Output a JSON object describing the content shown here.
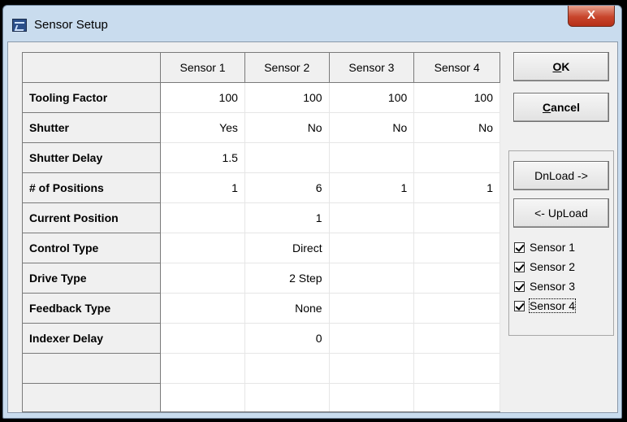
{
  "window": {
    "title": "Sensor Setup",
    "close_glyph": "X"
  },
  "grid": {
    "columns": [
      "Sensor 1",
      "Sensor 2",
      "Sensor 3",
      "Sensor 4"
    ],
    "rows": [
      {
        "label": "Tooling Factor",
        "values": [
          "100",
          "100",
          "100",
          "100"
        ]
      },
      {
        "label": "Shutter",
        "values": [
          "Yes",
          "No",
          "No",
          "No"
        ]
      },
      {
        "label": "Shutter Delay",
        "values": [
          "1.5",
          "",
          "",
          ""
        ]
      },
      {
        "label": "# of Positions",
        "values": [
          "1",
          "6",
          "1",
          "1"
        ]
      },
      {
        "label": "Current Position",
        "values": [
          "",
          "1",
          "",
          ""
        ]
      },
      {
        "label": "Control Type",
        "values": [
          "",
          "Direct",
          "",
          ""
        ]
      },
      {
        "label": "Drive Type",
        "values": [
          "",
          "2 Step",
          "",
          ""
        ]
      },
      {
        "label": "Feedback Type",
        "values": [
          "",
          "None",
          "",
          ""
        ]
      },
      {
        "label": "Indexer Delay",
        "values": [
          "",
          "0",
          "",
          ""
        ]
      },
      {
        "label": "",
        "values": [
          "",
          "",
          "",
          ""
        ]
      },
      {
        "label": "",
        "values": [
          "",
          "",
          "",
          ""
        ]
      }
    ]
  },
  "buttons": {
    "ok_accel": "O",
    "ok_rest": "K",
    "cancel_accel": "C",
    "cancel_rest": "ancel",
    "download": "DnLoad ->",
    "upload": "<- UpLoad"
  },
  "checkboxes": [
    {
      "label": "Sensor 1",
      "checked": true
    },
    {
      "label": "Sensor 2",
      "checked": true
    },
    {
      "label": "Sensor 3",
      "checked": true
    },
    {
      "label": "Sensor 4",
      "checked": true
    }
  ]
}
